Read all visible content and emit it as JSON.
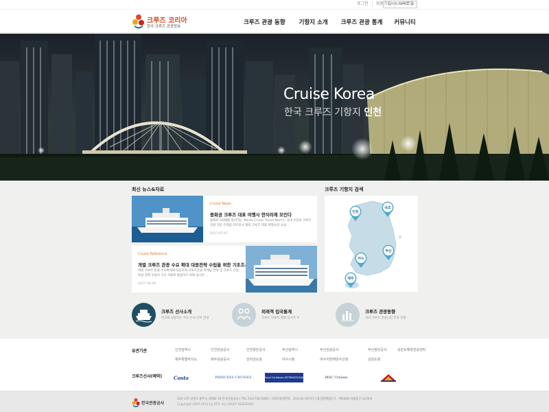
{
  "utility": {
    "links": [
      "로그인",
      "회원가입",
      "사이트맵"
    ],
    "language": "LANGUAGE"
  },
  "header": {
    "logo_title": "크루즈 코리아",
    "logo_subtitle": "한국 크루즈 관광정보",
    "nav": [
      "크루즈 관광 동향",
      "기항지 소개",
      "크루즈 관광 통계",
      "커뮤니티"
    ]
  },
  "hero": {
    "title": "Cruise Korea",
    "subtitle_prefix": "한국 크루즈 기항지 ",
    "subtitle_highlight": "인천"
  },
  "news": {
    "section_title": "최신 뉴스&자료",
    "items": [
      {
        "category": "Cruise News",
        "headline": "중화권 크루즈 대표 여행사 한자리에 모인다",
        "body": "올해로 3회째를 맞이하는 'Korea Cruise Travel Mart'는 국내 유일의 크루즈관광 전문 트래블 마트로서 해외 크루즈 대표 여행사와 국내 ...",
        "date": "2017-07-07"
      },
      {
        "category": "Cruise Reference",
        "headline": "개별 크루즈 관광 수요 확대 대응전략 수립을 위한 기초조사",
        "body": "개별 크루즈 관광 수요확대에 대응하여 크루즈관광 마케팅 전략 및 크루즈 산업 육성 정책 수립의 기초 자료로 활용하기 위해 실시된 ...",
        "date": "2017-06-06"
      }
    ]
  },
  "port_search": {
    "section_title": "크루즈 기항지 검색",
    "ports": [
      "인천",
      "속초",
      "부산",
      "여수",
      "제주"
    ]
  },
  "quick_links": [
    {
      "title": "크루즈 선사소개",
      "description": "한국에 입항하는 주요 선사·선박 안내",
      "icon": "ship-icon",
      "color": "#1f4f63"
    },
    {
      "title": "외래객 입국통계",
      "description": "크루즈 외래객 월별 입국자 수",
      "icon": "people-icon",
      "color": "#c6d2d6"
    },
    {
      "title": "크루즈 관광동향",
      "description": "국내 크루즈 관광시장 주요 현황",
      "icon": "bar-chart-icon",
      "color": "#c6d2d6"
    }
  ],
  "related": {
    "label": "유관기관",
    "links": [
      "인천광역시",
      "인천관광공사",
      "인천항만공사",
      "부산광역시",
      "부산관광공사",
      "부산항만공사",
      "강원도해양관광센터",
      "제주특별자치도",
      "제주관광공사",
      "전라남도청",
      "여수시청",
      "여수지방해양수산청",
      "강원도청"
    ]
  },
  "partners": {
    "label": "크루즈선사(예약)",
    "logos": [
      "Costa",
      "PRINCESS CRUISES",
      "Royal Caribbean INTERNATIONAL",
      "MSC Cruises",
      "STAR CRUISES"
    ]
  },
  "footer": {
    "org_name": "한국관광공사",
    "address": "220-170 강원도 원주시 세계로 10 한국관광공사 | TEL 033)738-3000 | 사업자등록번호 : 202-81-50707 | 통신판매업신고 : 제2009-서울중구-1234호",
    "copyright": "Copyright 2007-2014 by KTO. ALL RIGHT RESERVED"
  }
}
